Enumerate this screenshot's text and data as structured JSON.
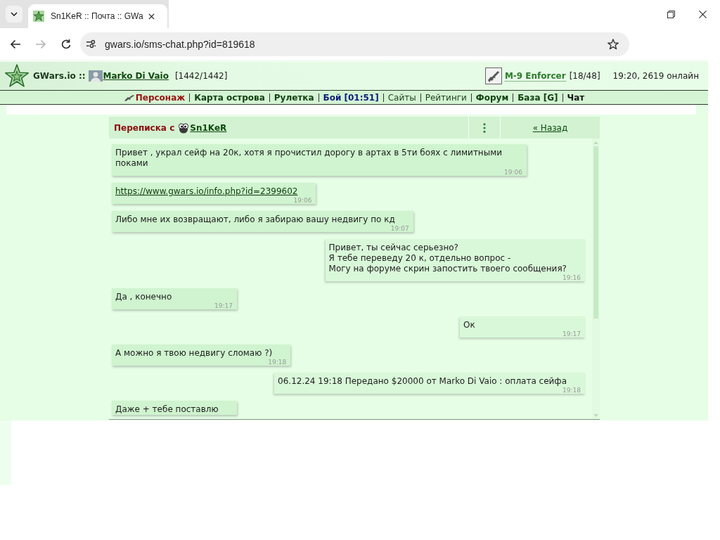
{
  "browser": {
    "tab": {
      "title": "Sn1KeR :: Почта :: GWa"
    },
    "nav_buttons": [
      {
        "kind": "back",
        "disabled": false
      },
      {
        "kind": "forward",
        "disabled": true
      },
      {
        "kind": "reload",
        "disabled": false
      }
    ],
    "address": "gwars.io/sms-chat.php?id=819618"
  },
  "header": {
    "site": "GWars.io ::",
    "user": "Marko Di Vaio",
    "hp": "[1442/1442]",
    "weapon": "M-9 Enforcer",
    "ammo": "[18/48]",
    "status": "19:20, 2619 онлайн"
  },
  "menu": [
    {
      "label": "Персонаж",
      "kind": "accent"
    },
    {
      "label": "Карта острова",
      "kind": "bold"
    },
    {
      "label": "Рулетка",
      "kind": "bold"
    },
    {
      "label": "Бой [01:51]",
      "kind": "alert"
    },
    {
      "label": "Сайты",
      "kind": "plain"
    },
    {
      "label": "Рейтинги",
      "kind": "plain"
    },
    {
      "label": "Форум",
      "kind": "bold"
    },
    {
      "label": "База [G]",
      "kind": "bold"
    },
    {
      "label": "Чат",
      "kind": "dark"
    }
  ],
  "chat": {
    "title": "Переписка с",
    "partner": "Sn1KeR",
    "back": "« Назад",
    "messages": [
      {
        "outgoing": false,
        "kind": "text",
        "text": "Привет , украл сейф на 20к, хотя я прочистил дорогу в артах в 5ти боях с лимитными поками",
        "time": "19:06"
      },
      {
        "outgoing": false,
        "kind": "link",
        "text": "https://www.gwars.io/info.php?id=2399602",
        "time": "19:06"
      },
      {
        "outgoing": false,
        "kind": "text",
        "text": "Либо мне их возвращают, либо я забираю вашу недвигу по кд",
        "time": "19:07"
      },
      {
        "outgoing": true,
        "kind": "text",
        "text": "Привет, ты сейчас серьезно?\nЯ тебе переведу 20 к, отдельно вопрос -\nМогу на форуме скрин запостить твоего сообщения?",
        "time": "19:16"
      },
      {
        "outgoing": false,
        "kind": "text",
        "text": "Да , конечно",
        "time": "19:17"
      },
      {
        "outgoing": true,
        "kind": "text",
        "text": "Ок",
        "time": "19:17"
      },
      {
        "outgoing": false,
        "kind": "text",
        "text": "А можно я твою недвигу сломаю ?)",
        "time": "19:18"
      },
      {
        "outgoing": true,
        "kind": "text",
        "text": "06.12.24 19:18 Передано $20000 от Marko Di Vaio : оплата сейфа",
        "time": "19:18"
      },
      {
        "outgoing": false,
        "kind": "text",
        "text": "Даже + тебе поставлю"
      }
    ]
  }
}
